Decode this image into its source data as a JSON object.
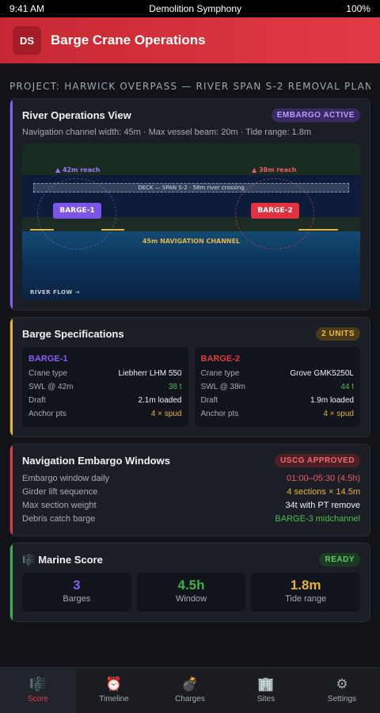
{
  "status_bar": {
    "time": "9:41 AM",
    "title": "Demolition Symphony",
    "battery": "100%"
  },
  "header": {
    "logo": "DS",
    "title": "Barge Crane Operations"
  },
  "project": "PROJECT: HARWICK OVERPASS — RIVER SPAN S-2 REMOVAL PLAN",
  "river_view": {
    "title": "River Operations View",
    "badge": "EMBARGO ACTIVE",
    "subline": "Navigation channel width: 45m · Max vessel beam: 20m · Tide range: 1.8m",
    "reach_1": "▲ 42m reach",
    "reach_2": "▲ 38m reach",
    "deck": "DECK — SPAN S-2 · 58m river crossing",
    "barge_1": "BARGE-1",
    "barge_2": "BARGE-2",
    "channel": "45m NAVIGATION CHANNEL",
    "flow": "RIVER FLOW →"
  },
  "specs": {
    "title": "Barge Specifications",
    "badge": "2 UNITS",
    "barges": [
      {
        "name": "BARGE-1",
        "color": "#8a5cf6",
        "crane_label": "Crane type",
        "crane": "Liebherr LHM 550",
        "swl_label": "SWL @ 42m",
        "swl": "38 t",
        "draft_label": "Draft",
        "draft": "2.1m loaded",
        "anchor_label": "Anchor pts",
        "anchor": "4 × spud"
      },
      {
        "name": "BARGE-2",
        "color": "#e23a45",
        "crane_label": "Crane type",
        "crane": "Grove GMK5250L",
        "swl_label": "SWL @ 38m",
        "swl": "44 t",
        "draft_label": "Draft",
        "draft": "1.9m loaded",
        "anchor_label": "Anchor pts",
        "anchor": "4 × spud"
      }
    ]
  },
  "embargo": {
    "title": "Navigation Embargo Windows",
    "badge": "USCG APPROVED",
    "rows": [
      {
        "k": "Embargo window daily",
        "v": "01:00–05:30 (4.5h)"
      },
      {
        "k": "Girder lift sequence",
        "v": "4 sections × 14.5m"
      },
      {
        "k": "Max section weight",
        "v": "34t with PT remove"
      },
      {
        "k": "Debris catch barge",
        "v": "BARGE-3 midchannel"
      }
    ]
  },
  "score": {
    "title": "Marine Score",
    "icon": "music-score-icon",
    "badge": "READY",
    "items": [
      {
        "value": "3",
        "label": "Barges",
        "color": "#8a5cf6"
      },
      {
        "value": "4.5h",
        "label": "Window",
        "color": "#3fae4c"
      },
      {
        "value": "1.8m",
        "label": "Tide range",
        "color": "#e7b23b"
      }
    ]
  },
  "tabs": [
    {
      "label": "Score",
      "icon": "🎼"
    },
    {
      "label": "Timeline",
      "icon": "⏰"
    },
    {
      "label": "Charges",
      "icon": "💣"
    },
    {
      "label": "Sites",
      "icon": "🏢"
    },
    {
      "label": "Settings",
      "icon": "⚙"
    }
  ]
}
